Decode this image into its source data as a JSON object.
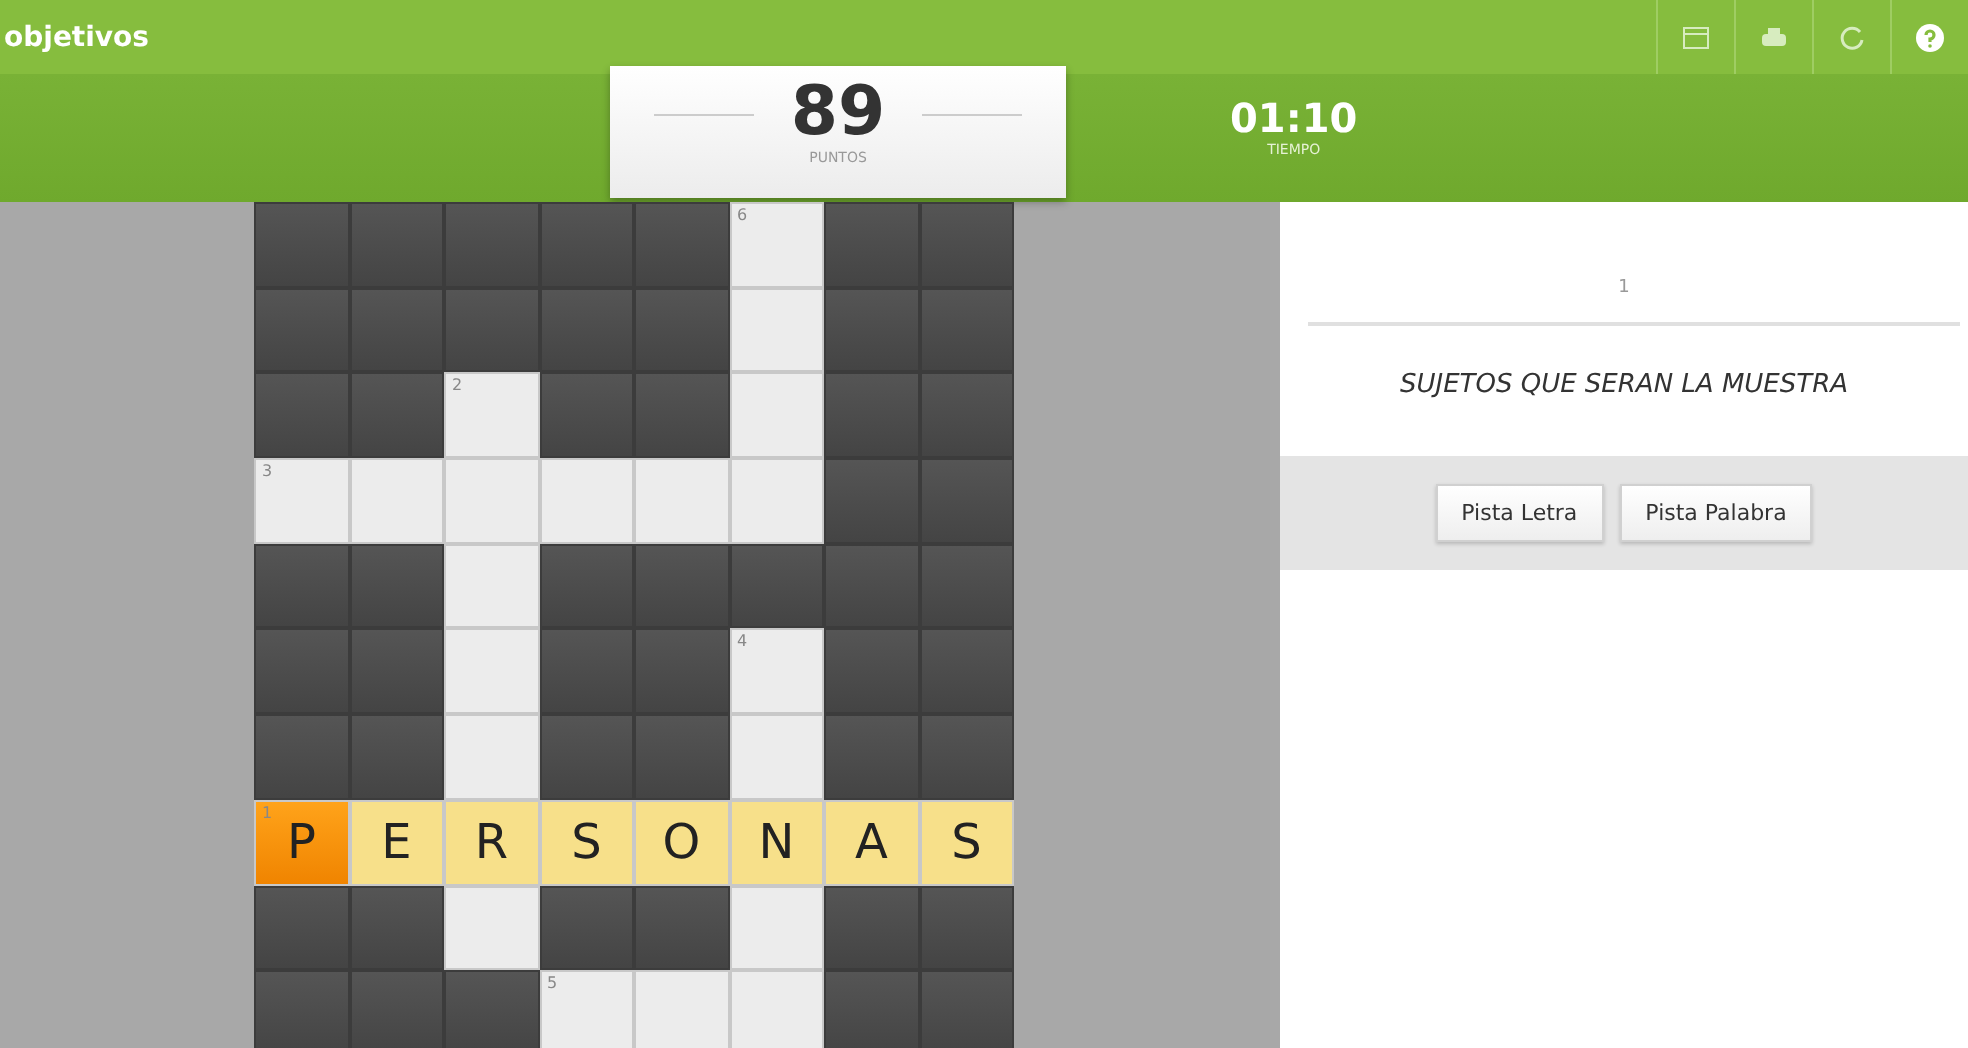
{
  "top_bar": {
    "title": "objetivos"
  },
  "score": {
    "value": "89",
    "label": "PUNTOS"
  },
  "timer": {
    "value": "01:10",
    "label": "TIEMPO"
  },
  "grid": {
    "rows": [
      [
        {
          "kind": "block"
        },
        {
          "kind": "block"
        },
        {
          "kind": "block"
        },
        {
          "kind": "block"
        },
        {
          "kind": "block"
        },
        {
          "kind": "blank",
          "number": "6"
        },
        {
          "kind": "block"
        },
        {
          "kind": "block"
        }
      ],
      [
        {
          "kind": "block"
        },
        {
          "kind": "block"
        },
        {
          "kind": "block"
        },
        {
          "kind": "block"
        },
        {
          "kind": "block"
        },
        {
          "kind": "blank"
        },
        {
          "kind": "block"
        },
        {
          "kind": "block"
        }
      ],
      [
        {
          "kind": "block"
        },
        {
          "kind": "block"
        },
        {
          "kind": "blank",
          "number": "2"
        },
        {
          "kind": "block"
        },
        {
          "kind": "block"
        },
        {
          "kind": "blank"
        },
        {
          "kind": "block"
        },
        {
          "kind": "block"
        }
      ],
      [
        {
          "kind": "blank",
          "number": "3"
        },
        {
          "kind": "blank"
        },
        {
          "kind": "blank"
        },
        {
          "kind": "blank"
        },
        {
          "kind": "blank"
        },
        {
          "kind": "blank"
        },
        {
          "kind": "block"
        },
        {
          "kind": "block"
        }
      ],
      [
        {
          "kind": "block"
        },
        {
          "kind": "block"
        },
        {
          "kind": "blank"
        },
        {
          "kind": "block"
        },
        {
          "kind": "block"
        },
        {
          "kind": "block"
        },
        {
          "kind": "block"
        },
        {
          "kind": "block"
        }
      ],
      [
        {
          "kind": "block"
        },
        {
          "kind": "block"
        },
        {
          "kind": "blank"
        },
        {
          "kind": "block"
        },
        {
          "kind": "block"
        },
        {
          "kind": "blank",
          "number": "4"
        },
        {
          "kind": "block"
        },
        {
          "kind": "block"
        }
      ],
      [
        {
          "kind": "block"
        },
        {
          "kind": "block"
        },
        {
          "kind": "blank"
        },
        {
          "kind": "block"
        },
        {
          "kind": "block"
        },
        {
          "kind": "blank"
        },
        {
          "kind": "block"
        },
        {
          "kind": "block"
        }
      ],
      [
        {
          "kind": "letter",
          "number": "1",
          "letter": "P",
          "selected": true
        },
        {
          "kind": "letter",
          "letter": "E",
          "selected": false
        },
        {
          "kind": "letter",
          "letter": "R",
          "selected": false
        },
        {
          "kind": "letter",
          "letter": "S",
          "selected": false
        },
        {
          "kind": "letter",
          "letter": "O",
          "selected": false
        },
        {
          "kind": "letter",
          "letter": "N",
          "selected": false
        },
        {
          "kind": "letter",
          "letter": "A",
          "selected": false
        },
        {
          "kind": "letter",
          "letter": "S",
          "selected": false
        }
      ],
      [
        {
          "kind": "block"
        },
        {
          "kind": "block"
        },
        {
          "kind": "blank"
        },
        {
          "kind": "block"
        },
        {
          "kind": "block"
        },
        {
          "kind": "blank"
        },
        {
          "kind": "block"
        },
        {
          "kind": "block"
        }
      ],
      [
        {
          "kind": "block"
        },
        {
          "kind": "block"
        },
        {
          "kind": "block"
        },
        {
          "kind": "blank",
          "number": "5"
        },
        {
          "kind": "blank"
        },
        {
          "kind": "blank"
        },
        {
          "kind": "block"
        },
        {
          "kind": "block"
        }
      ]
    ]
  },
  "clue": {
    "number": "1",
    "text": "SUJETOS QUE SERAN LA MUESTRA"
  },
  "buttons": [
    "Pista Letra",
    "Pista Palabra"
  ]
}
